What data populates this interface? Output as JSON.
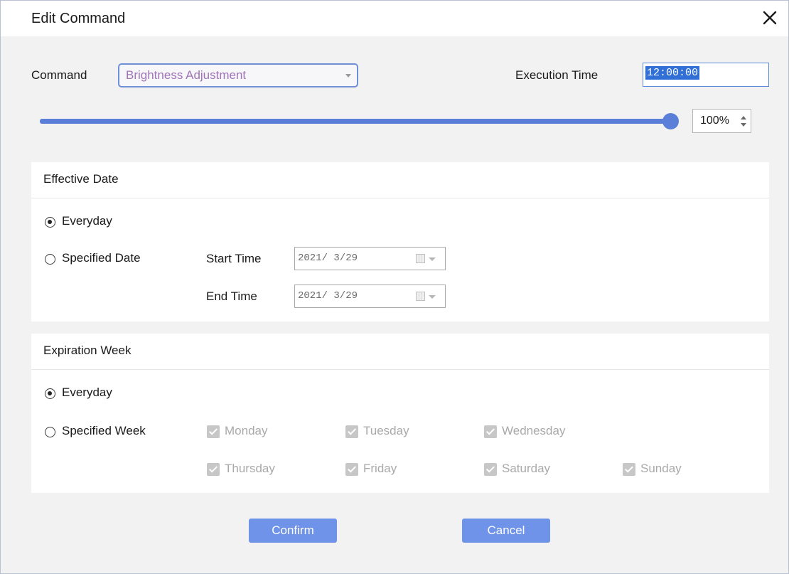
{
  "dialog": {
    "title": "Edit Command",
    "close_icon": "close-icon"
  },
  "command": {
    "label": "Command",
    "selected": "Brightness Adjustment"
  },
  "execution_time": {
    "label": "Execution Time",
    "value": "12:00:00"
  },
  "brightness": {
    "percent": 100,
    "display": "100%"
  },
  "effective_date": {
    "header": "Effective Date",
    "everyday_label": "Everyday",
    "specified_label": "Specified Date",
    "selected": "everyday",
    "start_label": "Start Time",
    "start_value": "2021/ 3/29",
    "end_label": "End Time",
    "end_value": "2021/ 3/29"
  },
  "expiration_week": {
    "header": "Expiration Week",
    "everyday_label": "Everyday",
    "specified_label": "Specified Week",
    "selected": "everyday",
    "days": [
      "Monday",
      "Tuesday",
      "Wednesday",
      "Thursday",
      "Friday",
      "Saturday",
      "Sunday"
    ]
  },
  "buttons": {
    "confirm": "Confirm",
    "cancel": "Cancel"
  },
  "colors": {
    "accent": "#5b7fd9",
    "button": "#6f93e8",
    "selection": "#2f6fd6",
    "combo_text": "#a074b8"
  }
}
